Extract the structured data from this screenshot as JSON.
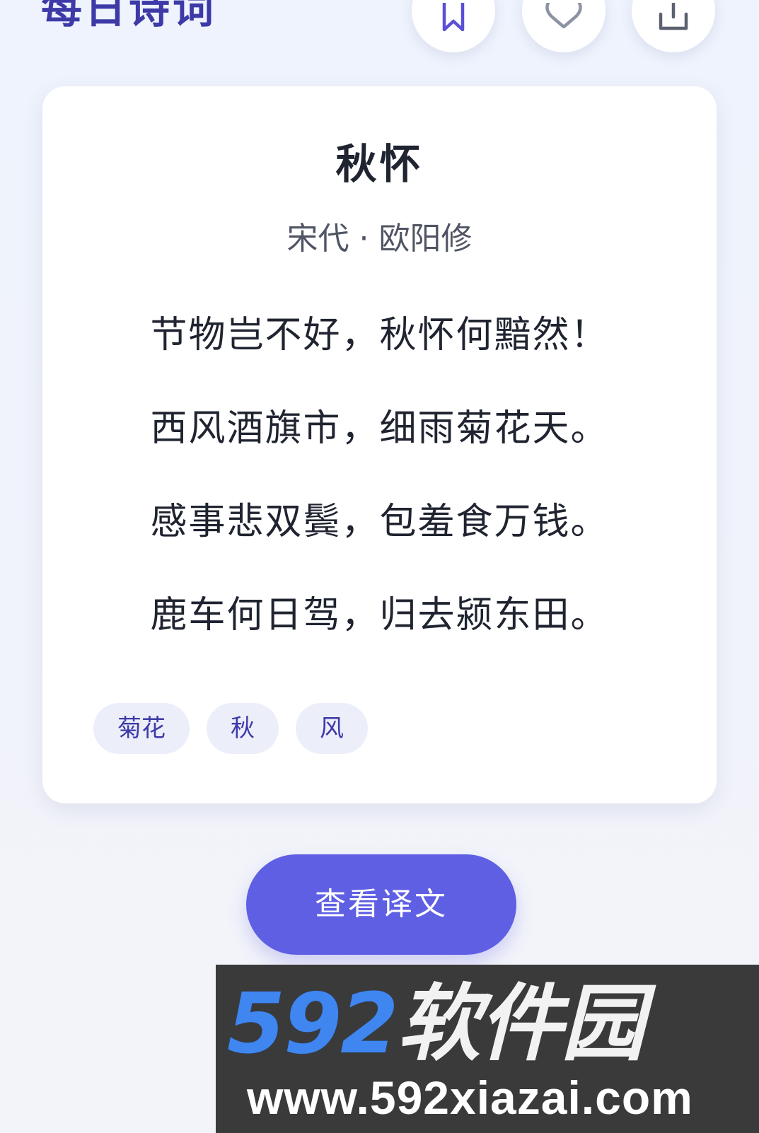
{
  "header": {
    "title": "每日诗词",
    "actions": [
      {
        "name": "bookmark",
        "icon": "bookmark-icon"
      },
      {
        "name": "like",
        "icon": "heart-icon"
      },
      {
        "name": "share",
        "icon": "share-icon"
      }
    ]
  },
  "poem": {
    "title": "秋怀",
    "dynasty": "宋代",
    "separator": "·",
    "author": "欧阳修",
    "lines": [
      "节物岂不好，秋怀何黯然！",
      "西风酒旗市，细雨菊花天。",
      "感事悲双鬓，包羞食万钱。",
      "鹿车何日驾，归去颍东田。"
    ],
    "tags": [
      "菊花",
      "秋",
      "风"
    ]
  },
  "actions": {
    "view_translation_label": "查看译文"
  },
  "watermark": {
    "brand_number": "592",
    "brand_text": "软件园",
    "url": "www.592xiazai.com"
  },
  "colors": {
    "accent": "#5f5fe4",
    "title": "#3d3aa8",
    "tag_bg": "#eceef9",
    "text": "#1f2430"
  }
}
